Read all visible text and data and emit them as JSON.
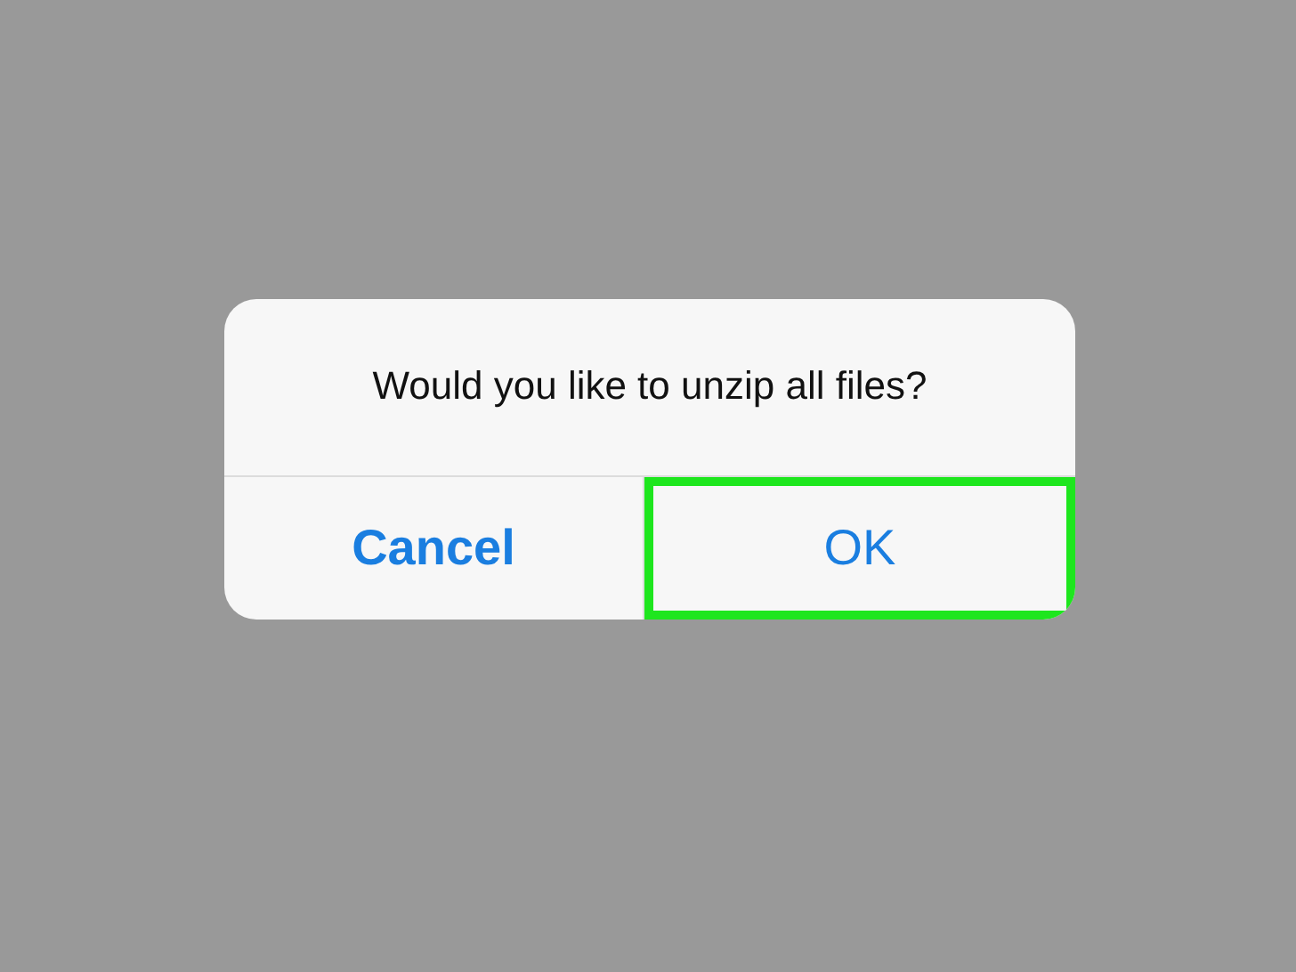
{
  "dialog": {
    "message": "Would you like to unzip all files?",
    "buttons": [
      {
        "label": "Cancel",
        "bold": true,
        "highlighted": false
      },
      {
        "label": "OK",
        "bold": false,
        "highlighted": true
      }
    ]
  }
}
